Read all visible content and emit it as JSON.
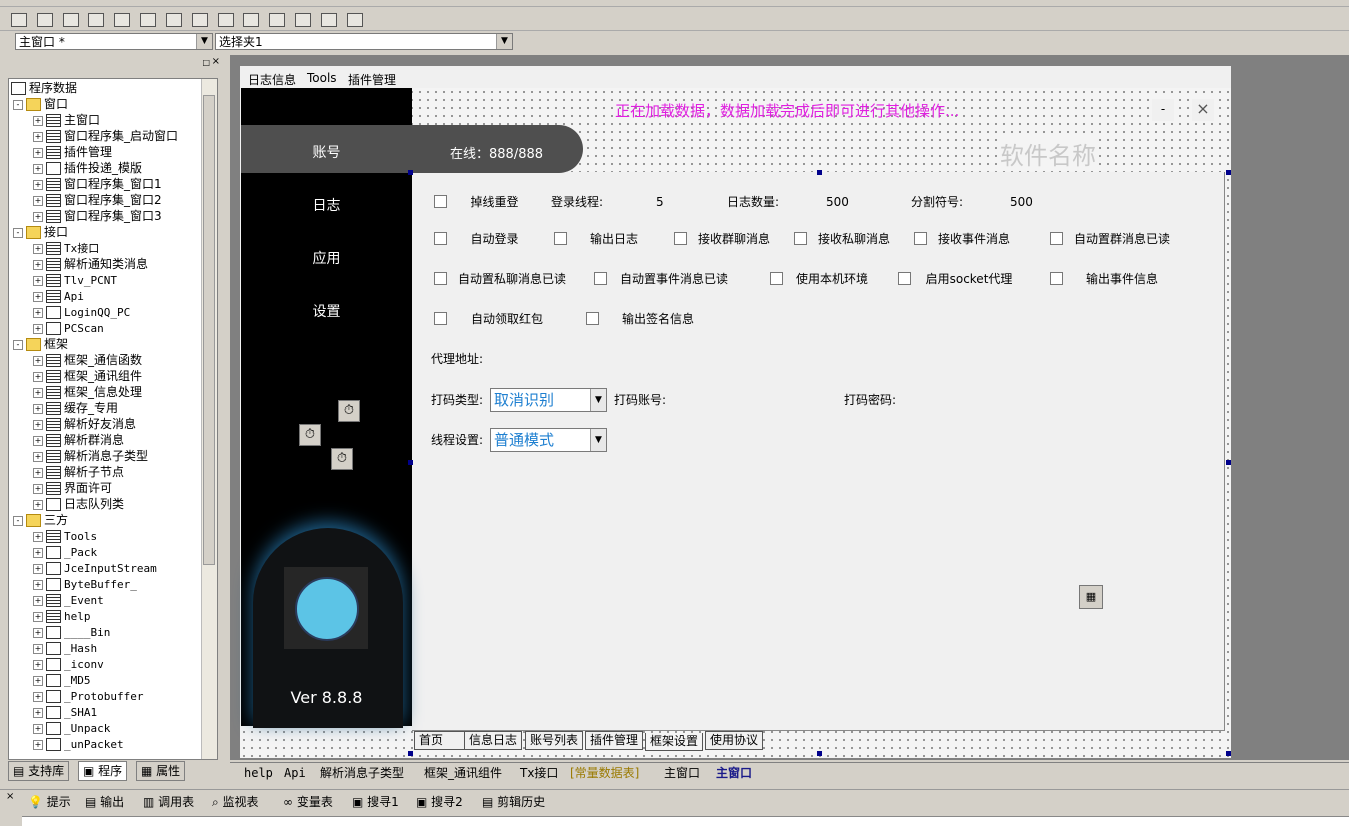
{
  "toolbar": {
    "window_select": "主窗口 *",
    "container_select": "选择夹1"
  },
  "tree": {
    "root": "程序数据",
    "items": [
      {
        "level": 0,
        "pm": "-",
        "icon": "folder",
        "label": "窗口",
        "mono": false
      },
      {
        "level": 1,
        "pm": "+",
        "icon": "stack",
        "label": "主窗口",
        "mono": false
      },
      {
        "level": 1,
        "pm": "+",
        "icon": "stack",
        "label": "窗口程序集_启动窗口",
        "mono": false
      },
      {
        "level": 1,
        "pm": "+",
        "icon": "stack",
        "label": "插件管理",
        "mono": false
      },
      {
        "level": 1,
        "pm": "+",
        "icon": "doc",
        "label": "插件投递_模版",
        "mono": false
      },
      {
        "level": 1,
        "pm": "+",
        "icon": "stack",
        "label": "窗口程序集_窗口1",
        "mono": false
      },
      {
        "level": 1,
        "pm": "+",
        "icon": "stack",
        "label": "窗口程序集_窗口2",
        "mono": false
      },
      {
        "level": 1,
        "pm": "+",
        "icon": "stack",
        "label": "窗口程序集_窗口3",
        "mono": false
      },
      {
        "level": 0,
        "pm": "-",
        "icon": "folder",
        "label": "接口",
        "mono": false
      },
      {
        "level": 1,
        "pm": "+",
        "icon": "stack",
        "label": "Tx接口",
        "mono": true
      },
      {
        "level": 1,
        "pm": "+",
        "icon": "stack",
        "label": "解析通知类消息",
        "mono": false
      },
      {
        "level": 1,
        "pm": "+",
        "icon": "stack",
        "label": "Tlv_PCNT",
        "mono": true
      },
      {
        "level": 1,
        "pm": "+",
        "icon": "stack",
        "label": "Api",
        "mono": true
      },
      {
        "level": 1,
        "pm": "+",
        "icon": "doc",
        "label": "LoginQQ_PC",
        "mono": true
      },
      {
        "level": 1,
        "pm": "+",
        "icon": "doc",
        "label": "PCScan",
        "mono": true
      },
      {
        "level": 0,
        "pm": "-",
        "icon": "folder",
        "label": "框架",
        "mono": false
      },
      {
        "level": 1,
        "pm": "+",
        "icon": "stack",
        "label": "框架_通信函数",
        "mono": false
      },
      {
        "level": 1,
        "pm": "+",
        "icon": "stack",
        "label": "框架_通讯组件",
        "mono": false
      },
      {
        "level": 1,
        "pm": "+",
        "icon": "stack",
        "label": "框架_信息处理",
        "mono": false
      },
      {
        "level": 1,
        "pm": "+",
        "icon": "stack",
        "label": "缓存_专用",
        "mono": false
      },
      {
        "level": 1,
        "pm": "+",
        "icon": "stack",
        "label": "解析好友消息",
        "mono": false
      },
      {
        "level": 1,
        "pm": "+",
        "icon": "stack",
        "label": "解析群消息",
        "mono": false
      },
      {
        "level": 1,
        "pm": "+",
        "icon": "stack",
        "label": "解析消息子类型",
        "mono": false
      },
      {
        "level": 1,
        "pm": "+",
        "icon": "stack",
        "label": "解析子节点",
        "mono": false
      },
      {
        "level": 1,
        "pm": "+",
        "icon": "stack",
        "label": "界面许可",
        "mono": false
      },
      {
        "level": 1,
        "pm": "+",
        "icon": "doc",
        "label": "日志队列类",
        "mono": false
      },
      {
        "level": 0,
        "pm": "-",
        "icon": "folder",
        "label": "三方",
        "mono": false
      },
      {
        "level": 1,
        "pm": "+",
        "icon": "stack",
        "label": "Tools",
        "mono": true
      },
      {
        "level": 1,
        "pm": "+",
        "icon": "doc",
        "label": "_Pack",
        "mono": true
      },
      {
        "level": 1,
        "pm": "+",
        "icon": "doc",
        "label": "JceInputStream",
        "mono": true
      },
      {
        "level": 1,
        "pm": "+",
        "icon": "doc",
        "label": "ByteBuffer_",
        "mono": true
      },
      {
        "level": 1,
        "pm": "+",
        "icon": "stack",
        "label": "_Event",
        "mono": true
      },
      {
        "level": 1,
        "pm": "+",
        "icon": "stack",
        "label": "help",
        "mono": true
      },
      {
        "level": 1,
        "pm": "+",
        "icon": "doc",
        "label": "____Bin",
        "mono": true
      },
      {
        "level": 1,
        "pm": "+",
        "icon": "doc",
        "label": "_Hash",
        "mono": true
      },
      {
        "level": 1,
        "pm": "+",
        "icon": "doc",
        "label": "_iconv",
        "mono": true
      },
      {
        "level": 1,
        "pm": "+",
        "icon": "doc",
        "label": "_MD5",
        "mono": true
      },
      {
        "level": 1,
        "pm": "+",
        "icon": "doc",
        "label": "_Protobuffer",
        "mono": true
      },
      {
        "level": 1,
        "pm": "+",
        "icon": "doc",
        "label": "_SHA1",
        "mono": true
      },
      {
        "level": 1,
        "pm": "+",
        "icon": "doc",
        "label": "_Unpack",
        "mono": true
      },
      {
        "level": 1,
        "pm": "+",
        "icon": "doc",
        "label": "_unPacket",
        "mono": true
      }
    ]
  },
  "left_tabs": [
    "支持库",
    "程序",
    "属性"
  ],
  "form": {
    "menu": [
      "日志信息",
      "Tools",
      "插件管理"
    ],
    "loading_text": "正在加载数据，数据加载完成后即可进行其他操作...",
    "software_name": "软件名称",
    "minimize": "-",
    "close": "×",
    "online_text": "在线：888/888",
    "nav": [
      "账号",
      "日志",
      "应用",
      "设置"
    ],
    "version": "Ver 8.8.8",
    "checkboxes": [
      {
        "label": "掉线重登"
      },
      {
        "label": "自动登录"
      },
      {
        "label": "输出日志"
      },
      {
        "label": "接收群聊消息"
      },
      {
        "label": "接收私聊消息"
      },
      {
        "label": "接收事件消息"
      },
      {
        "label": "自动置群消息已读"
      },
      {
        "label": "自动置私聊消息已读"
      },
      {
        "label": "自动置事件消息已读"
      },
      {
        "label": "使用本机环境"
      },
      {
        "label": "启用socket代理"
      },
      {
        "label": "输出事件信息"
      },
      {
        "label": "自动领取红包"
      },
      {
        "label": "输出签名信息"
      }
    ],
    "login_threads_label": "登录线程:",
    "login_threads_value": "5",
    "log_count_label": "日志数量:",
    "log_count_value": "500",
    "separator_label": "分割符号:",
    "separator_value": "500",
    "proxy_label": "代理地址:",
    "captcha_type_label": "打码类型:",
    "captcha_type_value": "取消识别",
    "captcha_account_label": "打码账号:",
    "captcha_password_label": "打码密码:",
    "thread_setting_label": "线程设置:",
    "thread_setting_value": "普通模式",
    "tabs": [
      "首页",
      "信息日志",
      "账号列表",
      "插件管理",
      "框架设置",
      "使用协议"
    ]
  },
  "editor_tabs": [
    "help",
    "Api",
    "解析消息子类型",
    "框架_通讯组件",
    "Tx接口",
    "[常量数据表]",
    "主窗口",
    "主窗口"
  ],
  "bottom_buttons": [
    "提示",
    "输出",
    "调用表",
    "监视表",
    "变量表",
    "搜寻1",
    "搜寻2",
    "剪辑历史"
  ]
}
